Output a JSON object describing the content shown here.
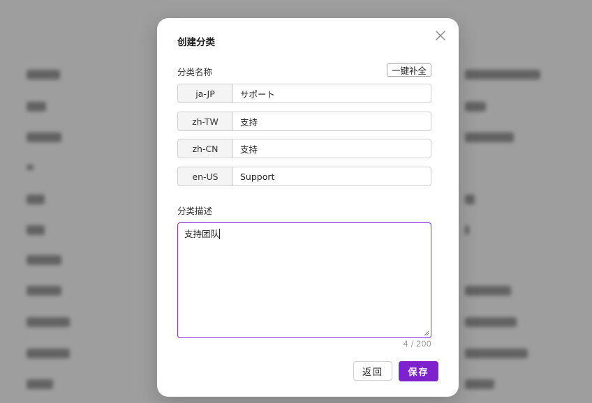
{
  "dialog": {
    "title": "创建分类",
    "close_icon": "close-icon",
    "name_label": "分类名称",
    "autofill_label": "一键补全",
    "languages": [
      {
        "code": "ja-JP",
        "value": "サポート"
      },
      {
        "code": "zh-TW",
        "value": "支持"
      },
      {
        "code": "zh-CN",
        "value": "支持"
      },
      {
        "code": "en-US",
        "value": "Support"
      }
    ],
    "description_label": "分类描述",
    "description_value": "支持团队",
    "char_count": "4 / 200",
    "back_label": "返回",
    "save_label": "保存"
  },
  "colors": {
    "accent": "#7e22ce",
    "focus_border": "#8a2be2",
    "overlay": "#8c8a8c"
  }
}
